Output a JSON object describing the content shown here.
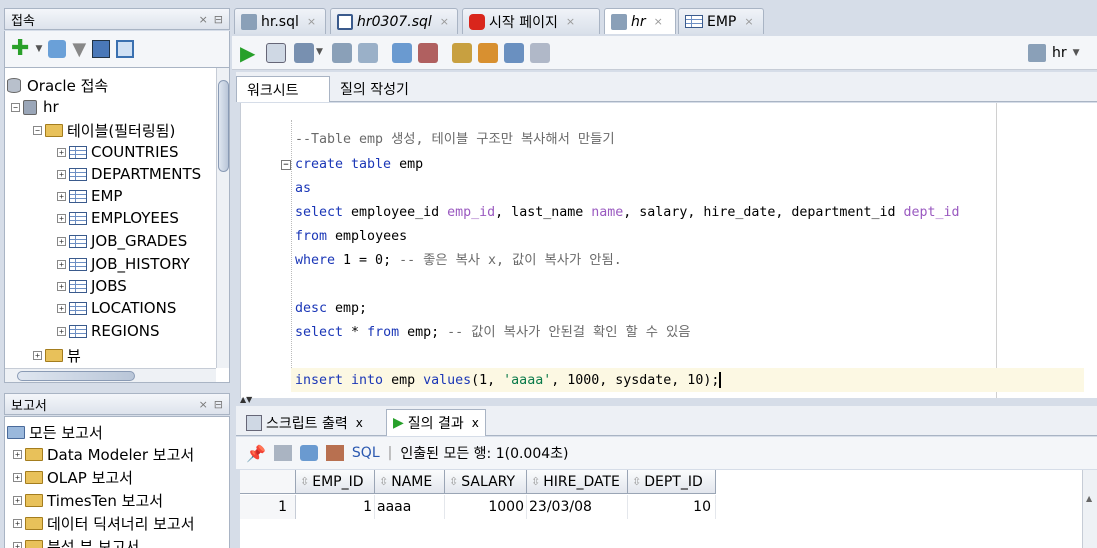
{
  "connections_panel": {
    "title": "접속",
    "tree": {
      "root_label": "Oracle 접속",
      "connection": "hr",
      "tables_folder": "테이블(필터링됨)",
      "tables": [
        "COUNTRIES",
        "DEPARTMENTS",
        "EMP",
        "EMPLOYEES",
        "JOB_GRADES",
        "JOB_HISTORY",
        "JOBS",
        "LOCATIONS",
        "REGIONS"
      ],
      "views_folder": "뷰"
    }
  },
  "reports_panel": {
    "title": "보고서",
    "items": [
      "모든 보고서",
      "Data Modeler 보고서",
      "OLAP 보고서",
      "TimesTen 보고서",
      "데이터 딕셔너리 보고서",
      "분석 뷰 보고서"
    ]
  },
  "tabs": [
    {
      "label": "hr.sql",
      "active": false
    },
    {
      "label": "hr0307.sql",
      "active": false
    },
    {
      "label": "시작 페이지",
      "active": false
    },
    {
      "label": "hr",
      "active": true
    },
    {
      "label": "EMP",
      "active": false
    }
  ],
  "toolbar": {
    "connection_label": "hr"
  },
  "worksheet": {
    "tabs": [
      "워크시트",
      "질의 작성기"
    ],
    "lines": [
      {
        "kind": "comment",
        "text": "--Table emp 생성, 테이블 구조만 복사해서 만들기"
      },
      {
        "kind": "code",
        "kw": "create table",
        "rest": " emp"
      },
      {
        "kind": "kwonly",
        "text": "as"
      },
      {
        "kind": "select",
        "text": "select employee_id emp_id, last_name name, salary, hire_date, department_id dept_id"
      },
      {
        "kind": "code",
        "kw": "from",
        "rest": " employees"
      },
      {
        "kind": "where",
        "kw": "where",
        "rest": " 1 = 0;",
        "comment": " -- 좋은 복사 x, 값이 복사가 안됨."
      },
      {
        "kind": "blank",
        "text": ""
      },
      {
        "kind": "code",
        "kw": "desc",
        "rest": " emp;"
      },
      {
        "kind": "select2",
        "kw1": "select",
        "mid": " * ",
        "kw2": "from",
        "rest": " emp;",
        "comment": " -- 값이 복사가 안된걸 확인 할 수 있음"
      },
      {
        "kind": "blank",
        "text": ""
      },
      {
        "kind": "insert",
        "kw1": "insert into",
        "mid": " emp ",
        "kw2": "values",
        "rest": "(1, ",
        "str": "'aaaa'",
        "tail": ", 1000, sysdate, 10);"
      }
    ]
  },
  "results": {
    "tabs": [
      {
        "label": "스크립트 출력",
        "close": "x"
      },
      {
        "label": "질의 결과",
        "close": "x"
      }
    ],
    "sql_label": "SQL",
    "status": "인출된 모든 행: 1(0.004초)",
    "columns": [
      "EMP_ID",
      "NAME",
      "SALARY",
      "HIRE_DATE",
      "DEPT_ID"
    ],
    "rows": [
      {
        "rownum": "1",
        "cells": [
          "1",
          "aaaa",
          "1000",
          "23/03/08",
          "10"
        ]
      }
    ]
  }
}
